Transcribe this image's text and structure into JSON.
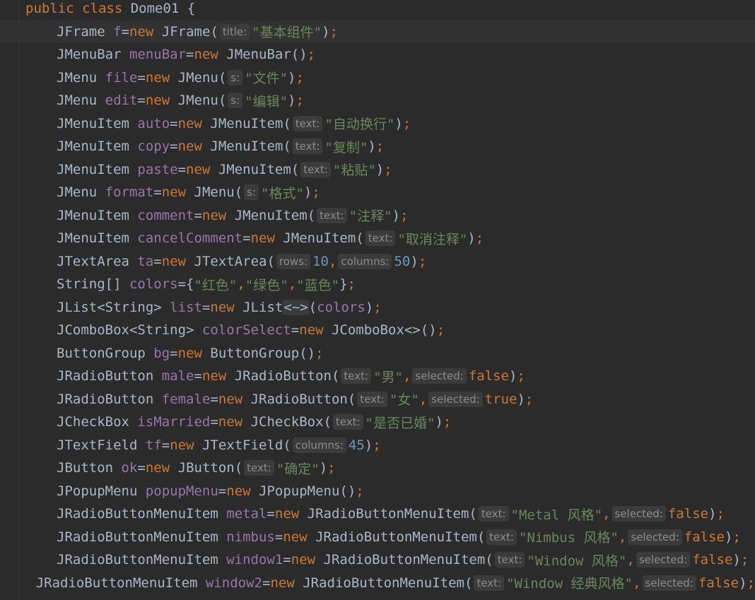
{
  "editor": {
    "lines": [
      {
        "indent": 0,
        "tokens": [
          [
            "kw",
            "public class "
          ],
          [
            "pl",
            "Dome01 {"
          ]
        ]
      },
      {
        "indent": 1,
        "current": true,
        "tokens": [
          [
            "pl",
            "JFrame "
          ],
          [
            "var",
            "f"
          ],
          [
            "pl",
            "="
          ],
          [
            "kw",
            "new "
          ],
          [
            "pl",
            "JFrame("
          ],
          [
            "hint",
            "title:"
          ],
          [
            "str",
            "\"基本组件\""
          ],
          [
            "pl",
            ")"
          ],
          [
            "semi",
            ";"
          ]
        ]
      },
      {
        "indent": 1,
        "tokens": [
          [
            "pl",
            "JMenuBar "
          ],
          [
            "var",
            "menuBar"
          ],
          [
            "pl",
            "="
          ],
          [
            "kw",
            "new "
          ],
          [
            "pl",
            "JMenuBar()"
          ],
          [
            "semi",
            ";"
          ]
        ]
      },
      {
        "indent": 1,
        "tokens": [
          [
            "pl",
            "JMenu "
          ],
          [
            "var",
            "file"
          ],
          [
            "pl",
            "="
          ],
          [
            "kw",
            "new "
          ],
          [
            "pl",
            "JMenu("
          ],
          [
            "hint",
            "s:"
          ],
          [
            "str",
            "\"文件\""
          ],
          [
            "pl",
            ")"
          ],
          [
            "semi",
            ";"
          ]
        ]
      },
      {
        "indent": 1,
        "tokens": [
          [
            "pl",
            "JMenu "
          ],
          [
            "var",
            "edit"
          ],
          [
            "pl",
            "="
          ],
          [
            "kw",
            "new "
          ],
          [
            "pl",
            "JMenu("
          ],
          [
            "hint",
            "s:"
          ],
          [
            "str",
            "\"编辑\""
          ],
          [
            "pl",
            ")"
          ],
          [
            "semi",
            ";"
          ]
        ]
      },
      {
        "indent": 1,
        "tokens": [
          [
            "pl",
            "JMenuItem "
          ],
          [
            "var",
            "auto"
          ],
          [
            "pl",
            "="
          ],
          [
            "kw",
            "new "
          ],
          [
            "pl",
            "JMenuItem("
          ],
          [
            "hint",
            "text:"
          ],
          [
            "str",
            "\"自动换行\""
          ],
          [
            "pl",
            ")"
          ],
          [
            "semi",
            ";"
          ]
        ]
      },
      {
        "indent": 1,
        "tokens": [
          [
            "pl",
            "JMenuItem "
          ],
          [
            "var",
            "copy"
          ],
          [
            "pl",
            "="
          ],
          [
            "kw",
            "new "
          ],
          [
            "pl",
            "JMenuItem("
          ],
          [
            "hint",
            "text:"
          ],
          [
            "str",
            "\"复制\""
          ],
          [
            "pl",
            ")"
          ],
          [
            "semi",
            ";"
          ]
        ]
      },
      {
        "indent": 1,
        "tokens": [
          [
            "pl",
            "JMenuItem "
          ],
          [
            "var",
            "paste"
          ],
          [
            "pl",
            "="
          ],
          [
            "kw",
            "new "
          ],
          [
            "pl",
            "JMenuItem("
          ],
          [
            "hint",
            "text:"
          ],
          [
            "str",
            "\"粘贴\""
          ],
          [
            "pl",
            ")"
          ],
          [
            "semi",
            ";"
          ]
        ]
      },
      {
        "indent": 1,
        "tokens": [
          [
            "pl",
            "JMenu "
          ],
          [
            "var",
            "format"
          ],
          [
            "pl",
            "="
          ],
          [
            "kw",
            "new "
          ],
          [
            "pl",
            "JMenu("
          ],
          [
            "hint",
            "s:"
          ],
          [
            "str",
            "\"格式\""
          ],
          [
            "pl",
            ")"
          ],
          [
            "semi",
            ";"
          ]
        ]
      },
      {
        "indent": 1,
        "tokens": [
          [
            "pl",
            "JMenuItem "
          ],
          [
            "var",
            "comment"
          ],
          [
            "pl",
            "="
          ],
          [
            "kw",
            "new "
          ],
          [
            "pl",
            "JMenuItem("
          ],
          [
            "hint",
            "text:"
          ],
          [
            "str",
            "\"注释\""
          ],
          [
            "pl",
            ")"
          ],
          [
            "semi",
            ";"
          ]
        ]
      },
      {
        "indent": 1,
        "tokens": [
          [
            "pl",
            "JMenuItem "
          ],
          [
            "var",
            "cancelComment"
          ],
          [
            "pl",
            "="
          ],
          [
            "kw",
            "new "
          ],
          [
            "pl",
            "JMenuItem("
          ],
          [
            "hint",
            "text:"
          ],
          [
            "str",
            "\"取消注释\""
          ],
          [
            "pl",
            ")"
          ],
          [
            "semi",
            ";"
          ]
        ]
      },
      {
        "indent": 1,
        "tokens": [
          [
            "pl",
            "JTextArea "
          ],
          [
            "var",
            "ta"
          ],
          [
            "pl",
            "="
          ],
          [
            "kw",
            "new "
          ],
          [
            "pl",
            "JTextArea("
          ],
          [
            "hint",
            "rows:"
          ],
          [
            "num",
            "10"
          ],
          [
            "semi",
            ","
          ],
          [
            "hint",
            "columns:"
          ],
          [
            "num",
            "50"
          ],
          [
            "pl",
            ")"
          ],
          [
            "semi",
            ";"
          ]
        ]
      },
      {
        "indent": 1,
        "tokens": [
          [
            "pl",
            "String[] "
          ],
          [
            "var",
            "colors"
          ],
          [
            "pl",
            "={"
          ],
          [
            "str",
            "\"红色\""
          ],
          [
            "semi",
            ","
          ],
          [
            "str",
            "\"绿色\""
          ],
          [
            "semi",
            ","
          ],
          [
            "str",
            "\"蓝色\""
          ],
          [
            "pl",
            "}"
          ],
          [
            "semi",
            ";"
          ]
        ]
      },
      {
        "indent": 1,
        "tokens": [
          [
            "pl",
            "JList<String> "
          ],
          [
            "var",
            "list"
          ],
          [
            "pl",
            "="
          ],
          [
            "kw",
            "new "
          ],
          [
            "pl",
            "JList"
          ],
          [
            "diamond",
            "<~>"
          ],
          [
            "pl",
            "("
          ],
          [
            "var",
            "colors"
          ],
          [
            "pl",
            ")"
          ],
          [
            "semi",
            ";"
          ]
        ]
      },
      {
        "indent": 1,
        "tokens": [
          [
            "pl",
            "JComboBox<String> "
          ],
          [
            "var",
            "colorSelect"
          ],
          [
            "pl",
            "="
          ],
          [
            "kw",
            "new "
          ],
          [
            "pl",
            "JComboBox<>()"
          ],
          [
            "semi",
            ";"
          ]
        ]
      },
      {
        "indent": 1,
        "tokens": [
          [
            "pl",
            "ButtonGroup "
          ],
          [
            "var",
            "bg"
          ],
          [
            "pl",
            "="
          ],
          [
            "kw",
            "new "
          ],
          [
            "pl",
            "ButtonGroup()"
          ],
          [
            "semi",
            ";"
          ]
        ]
      },
      {
        "indent": 1,
        "tokens": [
          [
            "pl",
            "JRadioButton "
          ],
          [
            "var",
            "male"
          ],
          [
            "pl",
            "="
          ],
          [
            "kw",
            "new "
          ],
          [
            "pl",
            "JRadioButton("
          ],
          [
            "hint",
            "text:"
          ],
          [
            "str",
            "\"男\""
          ],
          [
            "semi",
            ","
          ],
          [
            "hint",
            "selected:"
          ],
          [
            "kw",
            "false"
          ],
          [
            "pl",
            ")"
          ],
          [
            "semi",
            ";"
          ]
        ]
      },
      {
        "indent": 1,
        "tokens": [
          [
            "pl",
            "JRadioButton "
          ],
          [
            "var",
            "female"
          ],
          [
            "pl",
            "="
          ],
          [
            "kw",
            "new "
          ],
          [
            "pl",
            "JRadioButton("
          ],
          [
            "hint",
            "text:"
          ],
          [
            "str",
            "\"女\""
          ],
          [
            "semi",
            ","
          ],
          [
            "hint",
            "selected:"
          ],
          [
            "kw",
            "true"
          ],
          [
            "pl",
            ")"
          ],
          [
            "semi",
            ";"
          ]
        ]
      },
      {
        "indent": 1,
        "tokens": [
          [
            "pl",
            "JCheckBox "
          ],
          [
            "var",
            "isMarried"
          ],
          [
            "pl",
            "="
          ],
          [
            "kw",
            "new "
          ],
          [
            "pl",
            "JCheckBox("
          ],
          [
            "hint",
            "text:"
          ],
          [
            "str",
            "\"是否已婚\""
          ],
          [
            "pl",
            ")"
          ],
          [
            "semi",
            ";"
          ]
        ]
      },
      {
        "indent": 1,
        "tokens": [
          [
            "pl",
            "JTextField "
          ],
          [
            "var",
            "tf"
          ],
          [
            "pl",
            "="
          ],
          [
            "kw",
            "new "
          ],
          [
            "pl",
            "JTextField("
          ],
          [
            "hint",
            "columns:"
          ],
          [
            "num",
            "45"
          ],
          [
            "pl",
            ")"
          ],
          [
            "semi",
            ";"
          ]
        ]
      },
      {
        "indent": 1,
        "tokens": [
          [
            "pl",
            "JButton "
          ],
          [
            "var",
            "ok"
          ],
          [
            "pl",
            "="
          ],
          [
            "kw",
            "new "
          ],
          [
            "pl",
            "JButton("
          ],
          [
            "hint",
            "text:"
          ],
          [
            "str",
            "\"确定\""
          ],
          [
            "pl",
            ")"
          ],
          [
            "semi",
            ";"
          ]
        ]
      },
      {
        "indent": 1,
        "tokens": [
          [
            "pl",
            "JPopupMenu "
          ],
          [
            "var",
            "popupMenu"
          ],
          [
            "pl",
            "="
          ],
          [
            "kw",
            "new "
          ],
          [
            "pl",
            "JPopupMenu()"
          ],
          [
            "semi",
            ";"
          ]
        ]
      },
      {
        "indent": 1,
        "tokens": [
          [
            "pl",
            "JRadioButtonMenuItem "
          ],
          [
            "var",
            "metal"
          ],
          [
            "pl",
            "="
          ],
          [
            "kw",
            "new "
          ],
          [
            "pl",
            "JRadioButtonMenuItem("
          ],
          [
            "hint",
            "text:"
          ],
          [
            "str",
            "\"Metal 风格\""
          ],
          [
            "semi",
            ","
          ],
          [
            "hint",
            "selected:"
          ],
          [
            "kw",
            "false"
          ],
          [
            "pl",
            ")"
          ],
          [
            "semi",
            ";"
          ]
        ]
      },
      {
        "indent": 1,
        "tokens": [
          [
            "pl",
            "JRadioButtonMenuItem "
          ],
          [
            "var",
            "nimbus"
          ],
          [
            "pl",
            "="
          ],
          [
            "kw",
            "new "
          ],
          [
            "pl",
            "JRadioButtonMenuItem("
          ],
          [
            "hint",
            "text:"
          ],
          [
            "str",
            "\"Nimbus 风格\""
          ],
          [
            "semi",
            ","
          ],
          [
            "hint",
            "selected:"
          ],
          [
            "kw",
            "false"
          ],
          [
            "pl",
            ")"
          ],
          [
            "semi",
            ";"
          ]
        ]
      },
      {
        "indent": 1,
        "tokens": [
          [
            "pl",
            "JRadioButtonMenuItem "
          ],
          [
            "var",
            "window1"
          ],
          [
            "pl",
            "="
          ],
          [
            "kw",
            "new "
          ],
          [
            "pl",
            "JRadioButtonMenuItem("
          ],
          [
            "hint",
            "text:"
          ],
          [
            "str",
            "\"Window 风格\""
          ],
          [
            "semi",
            ","
          ],
          [
            "hint",
            "selected:"
          ],
          [
            "kw",
            "false"
          ],
          [
            "pl",
            ")"
          ],
          [
            "semi",
            ";"
          ]
        ]
      },
      {
        "indent": 1,
        "tokens": [
          [
            "pl",
            "JRadioButtonMenuItem "
          ],
          [
            "var",
            "window2"
          ],
          [
            "pl",
            "="
          ],
          [
            "kw",
            "new "
          ],
          [
            "pl",
            "JRadioButtonMenuItem("
          ],
          [
            "hint",
            "text:"
          ],
          [
            "str",
            "\"Window 经典风格\""
          ],
          [
            "semi",
            ","
          ],
          [
            "hint",
            "selected:"
          ],
          [
            "kw",
            "false"
          ],
          [
            "pl",
            ")"
          ],
          [
            "semi",
            ";"
          ]
        ]
      }
    ]
  },
  "colors": {
    "background": "#2b2b2b",
    "current_line": "#323232",
    "keyword": "#cc7832",
    "identifier": "#9876aa",
    "string": "#6a8759",
    "number": "#6897bb",
    "plain": "#a9b7c6",
    "inlay_hint": "#8c8c8c"
  }
}
